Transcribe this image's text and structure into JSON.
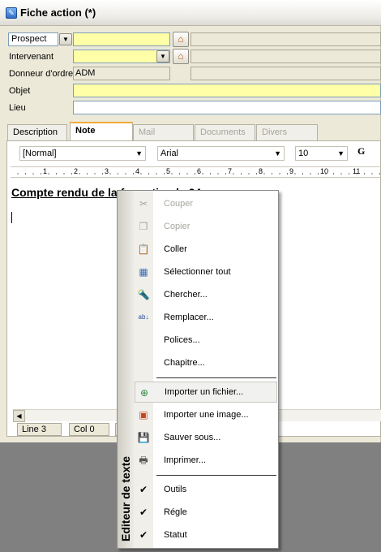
{
  "window": {
    "title": "Fiche action (*)"
  },
  "form": {
    "prospect_label": "Prospect",
    "intervenant_label": "Intervenant",
    "donneur_label": "Donneur d'ordre",
    "donneur_value": "ADM",
    "objet_label": "Objet",
    "lieu_label": "Lieu"
  },
  "tabs": [
    {
      "label": "Description",
      "state": "normal"
    },
    {
      "label": "Note",
      "state": "active"
    },
    {
      "label": "Mail",
      "state": "disabled"
    },
    {
      "label": "Documents",
      "state": "disabled"
    },
    {
      "label": "Divers",
      "state": "disabled"
    }
  ],
  "editor": {
    "style_value": "[Normal]",
    "font_value": "Arial",
    "size_value": "10",
    "bold_label": "G",
    "ruler_numbers": [
      "1",
      "2",
      "3",
      "4",
      "5",
      "6",
      "7",
      "8",
      "9",
      "10",
      "11"
    ],
    "text_line": "Compte rendu de la formation le 24",
    "status_line": "Line  3",
    "status_col": "Col  0"
  },
  "context_menu": {
    "side_label": "Editeur de texte",
    "items": [
      {
        "label": "Couper",
        "icon": "scissors-icon",
        "disabled": true
      },
      {
        "label": "Copier",
        "icon": "copy-icon",
        "disabled": true
      },
      {
        "label": "Coller",
        "icon": "paste-icon",
        "disabled": false
      },
      {
        "label": "Sélectionner tout",
        "icon": "select-all-icon",
        "disabled": false
      },
      {
        "label": "Chercher...",
        "icon": "search-icon",
        "disabled": false
      },
      {
        "label": "Remplacer...",
        "icon": "replace-icon",
        "disabled": false
      },
      {
        "label": "Polices...",
        "icon": "",
        "disabled": false
      },
      {
        "label": "Chapitre...",
        "icon": "",
        "disabled": false
      },
      {
        "label": "Importer un fichier...",
        "icon": "import-file-icon",
        "disabled": false,
        "highlighted": true
      },
      {
        "label": "Importer une image...",
        "icon": "import-image-icon",
        "disabled": false
      },
      {
        "label": "Sauver sous...",
        "icon": "save-icon",
        "disabled": false
      },
      {
        "label": "Imprimer...",
        "icon": "print-icon",
        "disabled": false
      },
      {
        "label": "Outils",
        "icon": "check-icon",
        "checked": true
      },
      {
        "label": "Régle",
        "icon": "check-icon",
        "checked": true
      },
      {
        "label": "Statut",
        "icon": "check-icon",
        "checked": true
      }
    ]
  }
}
